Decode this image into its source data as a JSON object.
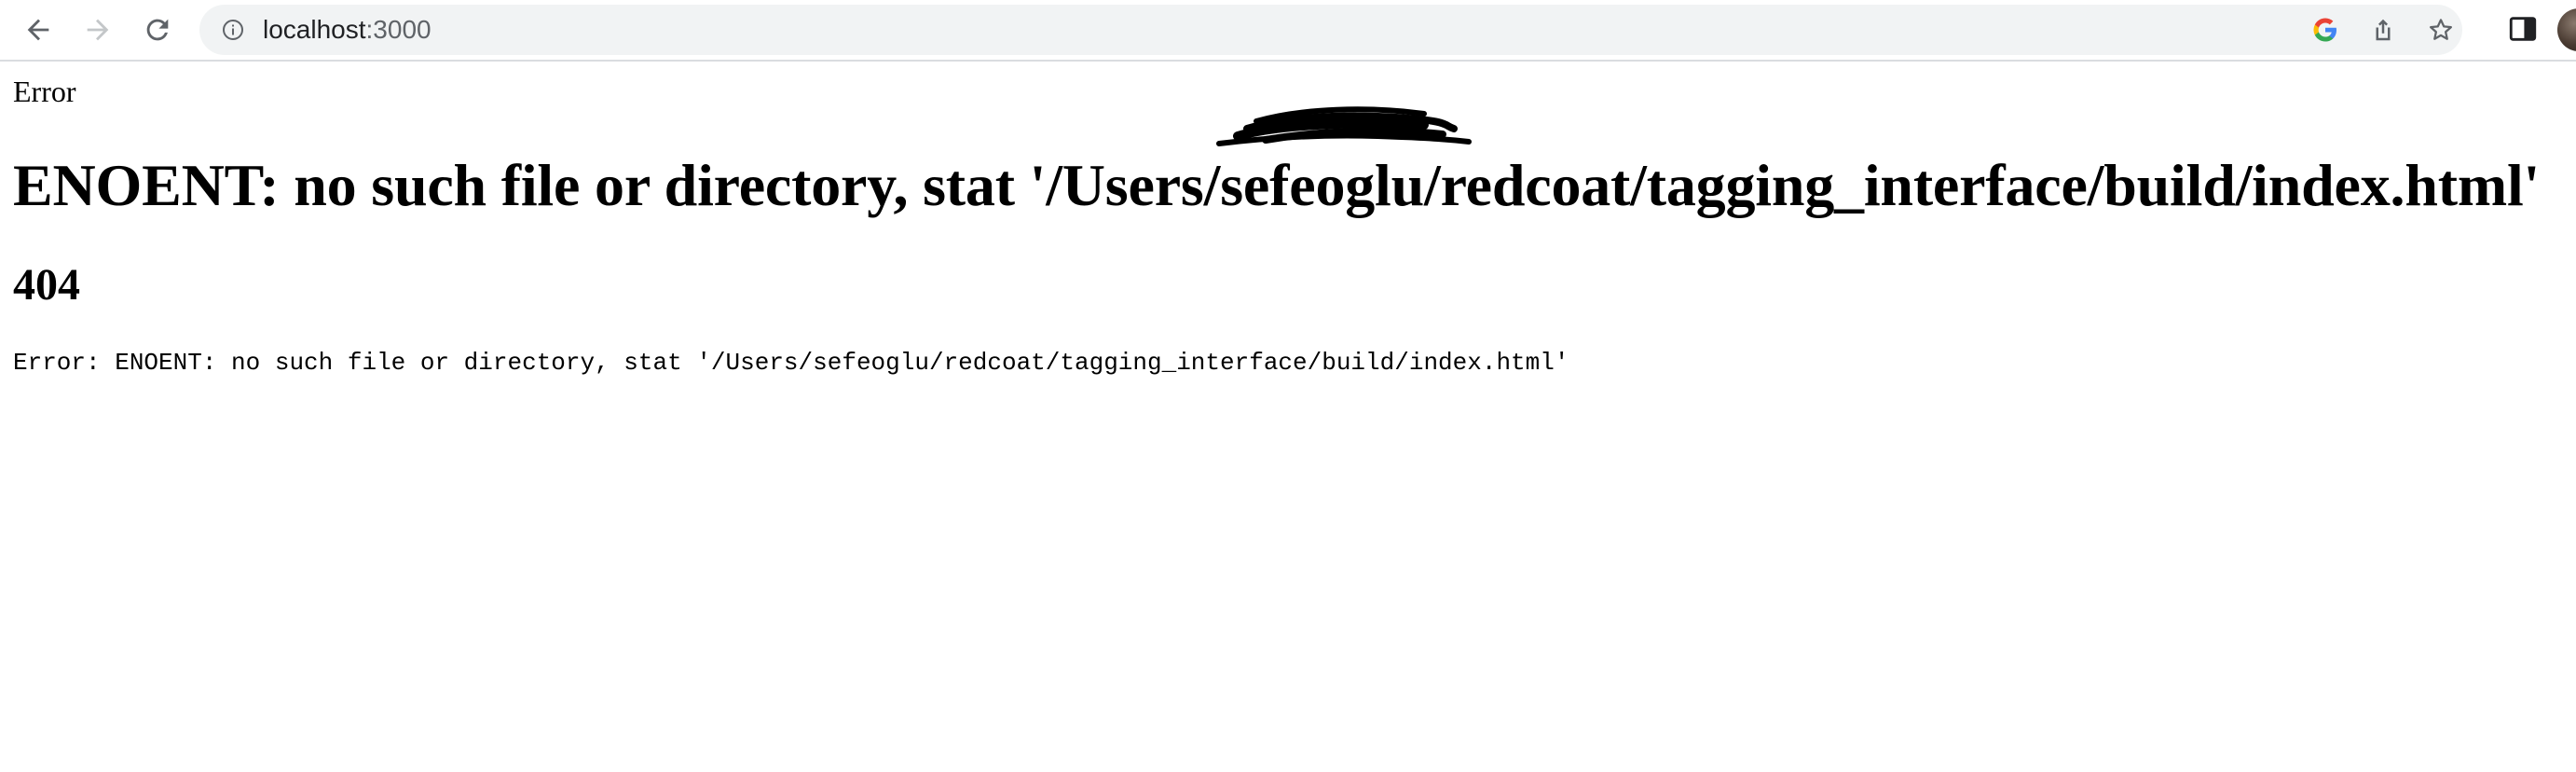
{
  "browser": {
    "url_host": "localhost",
    "url_port": ":3000",
    "icons": {
      "back": "arrow-left-icon",
      "forward": "arrow-right-icon",
      "reload": "reload-icon",
      "site_info": "info-icon",
      "google": "google-icon",
      "share": "share-icon",
      "bookmark": "star-icon",
      "side_panel": "side-panel-icon"
    }
  },
  "page": {
    "label": "Error",
    "title": "ENOENT: no such file or directory, stat '/Users/sefeoglu/redcoat/tagging_interface/build/index.html'",
    "status_code": "404",
    "stack": "Error: ENOENT: no such file or directory, stat '/Users/sefeoglu/redcoat/tagging_interface/build/index.html'"
  },
  "colors": {
    "toolbar_bg": "#ffffff",
    "omnibox_bg": "#f1f3f4",
    "icon_gray": "#5f6368",
    "text": "#000000"
  }
}
